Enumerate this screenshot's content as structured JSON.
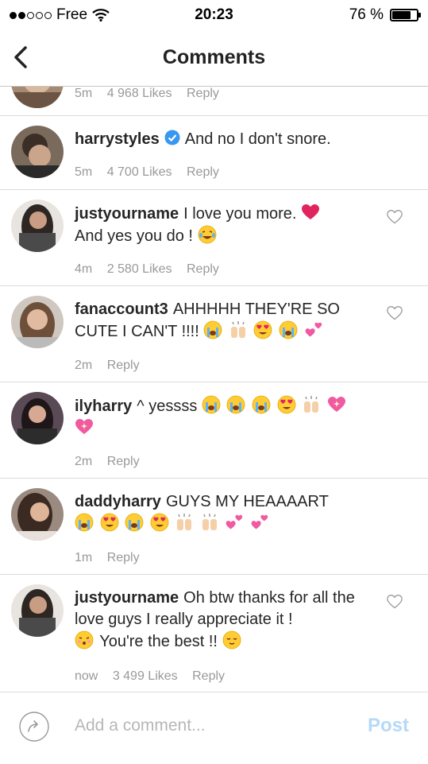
{
  "status": {
    "carrier": "Free",
    "time": "20:23",
    "battery": "76 %",
    "battery_level": 0.76
  },
  "nav": {
    "title": "Comments"
  },
  "partial": {
    "time": "5m",
    "likes": "4 968 Likes",
    "reply": "Reply"
  },
  "comments": [
    {
      "user": "harrystyles",
      "verified": true,
      "text": "And no I don't snore.",
      "time": "5m",
      "likes": "4 700 Likes",
      "reply": "Reply",
      "emojis": []
    },
    {
      "user": "justyourname",
      "text": "I love you more.",
      "text2": "And yes you do !",
      "time": "4m",
      "likes": "2 580 Likes",
      "reply": "Reply",
      "emojis": [
        "red-heart",
        "laughing-tears"
      ]
    },
    {
      "user": "fanaccount3",
      "text": "AHHHHH THEY'RE SO CUTE I CAN'T !!!!",
      "time": "2m",
      "reply": "Reply",
      "emojis": [
        "crying",
        "raised-hands",
        "heart-eyes",
        "crying",
        "two-hearts"
      ]
    },
    {
      "user": "ilyharry",
      "text": "^ yessss",
      "time": "2m",
      "reply": "Reply",
      "emojis": [
        "crying",
        "crying",
        "crying",
        "heart-eyes",
        "raised-hands",
        "sparkling-heart",
        "sparkling-heart"
      ]
    },
    {
      "user": "daddyharry",
      "text": "GUYS MY HEAAAART",
      "time": "1m",
      "reply": "Reply",
      "emojis": [
        "crying",
        "heart-eyes",
        "crying",
        "heart-eyes",
        "raised-hands",
        "raised-hands",
        "two-hearts",
        "two-hearts"
      ]
    },
    {
      "user": "justyourname",
      "text": "Oh btw thanks for all the love guys I really appreciate it !",
      "text2": "You're the best !!",
      "time": "now",
      "likes": "3 499 Likes",
      "reply": "Reply",
      "emojis": [
        "kissing",
        "relieved"
      ]
    }
  ],
  "compose": {
    "placeholder": "Add a comment...",
    "post_label": "Post"
  },
  "colors": {
    "post_disabled": "#b5d9f7",
    "verified": "#3897f0",
    "meta_text": "#999999"
  }
}
